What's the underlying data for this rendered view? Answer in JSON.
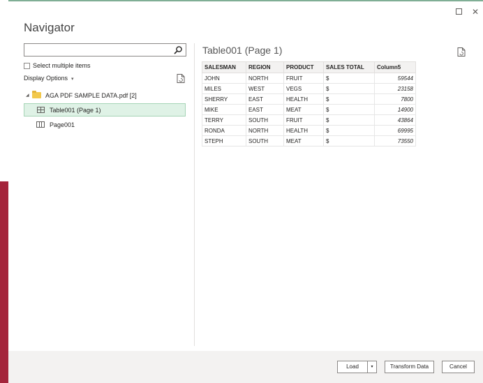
{
  "window": {
    "title": "Navigator",
    "maximize_icon": "maximize-icon",
    "close_label": "✕"
  },
  "search": {
    "value": "",
    "placeholder": "",
    "icon": "search-icon"
  },
  "select_multiple": {
    "label": "Select multiple items",
    "checked": false
  },
  "display_options": {
    "label": "Display Options",
    "caret": "▾"
  },
  "tree": {
    "file": {
      "label": "AGA PDF SAMPLE DATA.pdf [2]",
      "expander": "◢"
    },
    "items": [
      {
        "label": "Table001 (Page 1)",
        "icon": "table-icon",
        "selected": true
      },
      {
        "label": "Page001",
        "icon": "page-icon",
        "selected": false
      }
    ]
  },
  "preview": {
    "title": "Table001 (Page 1)",
    "columns": [
      "SALESMAN",
      "REGION",
      "PRODUCT",
      "SALES TOTAL",
      "Column5"
    ],
    "rows": [
      [
        "JOHN",
        "NORTH",
        "FRUIT",
        "$",
        "59544"
      ],
      [
        "MILES",
        "WEST",
        "VEGS",
        "$",
        "23158"
      ],
      [
        "SHERRY",
        "EAST",
        "HEALTH",
        "$",
        "7800"
      ],
      [
        "MIKE",
        "EAST",
        "MEAT",
        "$",
        "14900"
      ],
      [
        "TERRY",
        "SOUTH",
        "FRUIT",
        "$",
        "43864"
      ],
      [
        "RONDA",
        "NORTH",
        "HEALTH",
        "$",
        "69995"
      ],
      [
        "STEPH",
        "SOUTH",
        "MEAT",
        "$",
        "73550"
      ]
    ]
  },
  "footer": {
    "load_label": "Load",
    "load_dropdown": "▾",
    "transform_label": "Transform Data",
    "cancel_label": "Cancel"
  },
  "colors": {
    "accent_line": "#7fae95",
    "left_band": "#a4243b",
    "selected_bg": "#dff2e6",
    "folder": "#f2c84b"
  }
}
